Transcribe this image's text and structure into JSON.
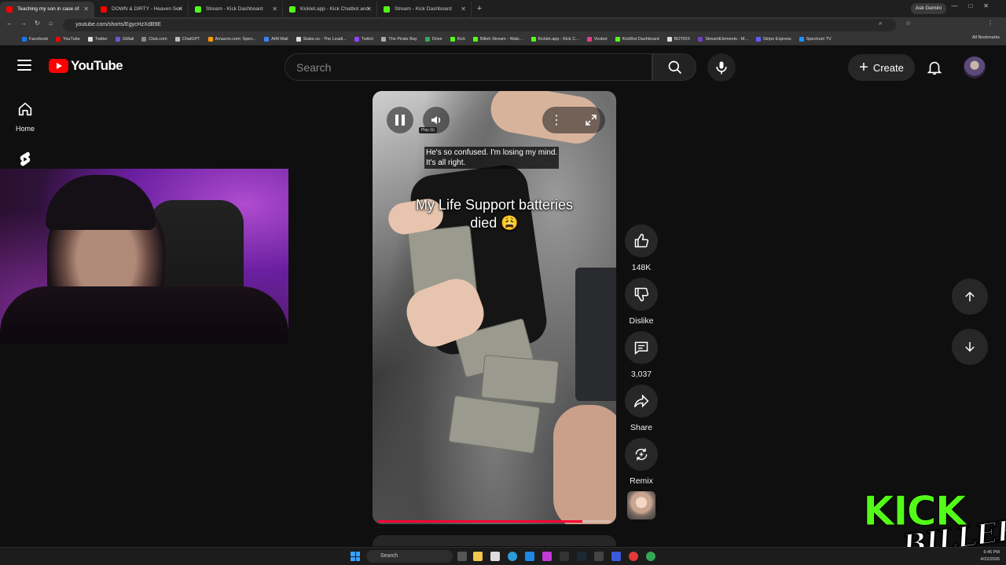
{
  "browser": {
    "tabs": [
      {
        "title": "Teaching my son in case of",
        "color": "#ff0000",
        "active": true
      },
      {
        "title": "DOWN & DIRTY - Heaven Seri",
        "color": "#ff0000",
        "active": false
      },
      {
        "title": "Stream - Kick Dashboard",
        "color": "#53fc18",
        "active": false
      },
      {
        "title": "Kicklet.app - Kick Chatbot and",
        "color": "#53fc18",
        "active": false
      },
      {
        "title": "Stream - Kick Dashboard",
        "color": "#53fc18",
        "active": false
      }
    ],
    "gemini_label": "Ask Gemini",
    "url": "youtube.com/shorts/EgycHzXdB9E",
    "bookmarks": [
      "Facebook",
      "YouTube",
      "Twitter",
      "GMail",
      "Club.com",
      "ChatGPT",
      "Amazon.com: Spen...",
      "AIM Mail",
      "Stake.us - The Leadi...",
      "Twitch",
      "The Pirate Bay",
      "Drive",
      "Kick",
      "Billeh Stream - Watc...",
      "Kicklet.app - Kick C...",
      "Voxbot",
      "KickBot Dashboard",
      "BOTRIX",
      "StreamElements - M...",
      "Stripe Express",
      "Spectrum TV"
    ],
    "all_bookmarks_label": "All Bookmarks"
  },
  "youtube": {
    "logo_text": "YouTube",
    "search_placeholder": "Search",
    "create_label": "Create",
    "nav": {
      "home_label": "Home"
    },
    "short": {
      "tooltip": "Play (k)",
      "caption": "He's so confused. I'm losing my mind.\nIt's all right.",
      "overlay_text": "My Life Support batteries died 😩",
      "progress": 0.88
    },
    "actions": {
      "like_count": "148K",
      "dislike_label": "Dislike",
      "comment_count": "3,037",
      "share_label": "Share",
      "remix_label": "Remix"
    }
  },
  "overlay": {
    "kick_word": "KICK",
    "signature": "BILLEH"
  },
  "taskbar": {
    "search_placeholder": "Search",
    "time": "6:45 PM",
    "date": "4/22/2026"
  },
  "colors": {
    "youtube_red": "#ff0000",
    "kick_green": "#53fc18",
    "progress_red": "#ff0033"
  }
}
